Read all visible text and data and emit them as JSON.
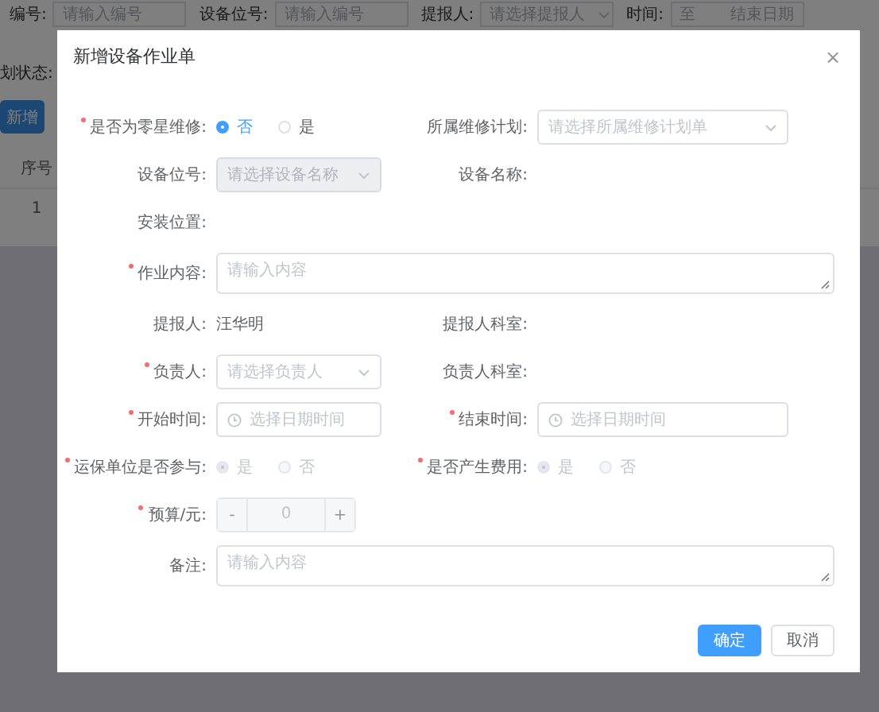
{
  "page": {
    "filters": [
      {
        "label": "编号:",
        "placeholder": "请输入编号",
        "kind": "input"
      },
      {
        "label": "设备位号:",
        "placeholder": "请输入编号",
        "kind": "input"
      },
      {
        "label": "提报人:",
        "placeholder": "请选择提报人",
        "kind": "select"
      },
      {
        "label": "时间:",
        "placeholder": "至",
        "placeholder_end": "结束日期",
        "kind": "range"
      }
    ],
    "status_filter_label": "划状态:",
    "buttons": [
      "新增"
    ],
    "table": {
      "columns": [
        "序号"
      ],
      "rows": [
        [
          "1"
        ]
      ]
    }
  },
  "dialog": {
    "title": "新增设备作业单",
    "close": "×",
    "rows": [
      [
        {
          "label": "是否为零星维修:",
          "required": true,
          "kind": "radio",
          "disabled": false,
          "options": [
            {
              "label": "否",
              "selected": true
            },
            {
              "label": "是",
              "selected": false
            }
          ]
        },
        {
          "label": "所属维修计划:",
          "required": false,
          "kind": "select",
          "placeholder": "请选择所属维修计划单",
          "disabled": false
        }
      ],
      [
        {
          "label": "设备位号:",
          "required": false,
          "kind": "select",
          "placeholder": "请选择设备名称",
          "disabled": true
        },
        {
          "label": "设备名称:",
          "required": false,
          "kind": "static"
        }
      ],
      [
        {
          "label": "安装位置:",
          "required": false,
          "kind": "static"
        }
      ],
      [
        {
          "label": "作业内容:",
          "required": true,
          "kind": "textarea",
          "placeholder": "请输入内容"
        }
      ],
      [
        {
          "label": "提报人:",
          "required": false,
          "kind": "static",
          "value": "汪华明"
        },
        {
          "label": "提报人科室:",
          "required": false,
          "kind": "static"
        }
      ],
      [
        {
          "label": "负责人:",
          "required": true,
          "kind": "select",
          "placeholder": "请选择负责人",
          "disabled": false
        },
        {
          "label": "负责人科室:",
          "required": false,
          "kind": "static"
        }
      ],
      [
        {
          "label": "开始时间:",
          "required": true,
          "kind": "date",
          "placeholder": "选择日期时间"
        },
        {
          "label": "结束时间:",
          "required": true,
          "kind": "date",
          "placeholder": "选择日期时间"
        }
      ],
      [
        {
          "label": "运保单位是否参与:",
          "required": true,
          "kind": "radio",
          "disabled": true,
          "options": [
            {
              "label": "是",
              "selected": true
            },
            {
              "label": "否",
              "selected": false
            }
          ]
        },
        {
          "label": "是否产生费用:",
          "required": true,
          "kind": "radio",
          "disabled": true,
          "options": [
            {
              "label": "是",
              "selected": true
            },
            {
              "label": "否",
              "selected": false
            }
          ]
        }
      ],
      [
        {
          "label": "预算/元:",
          "required": true,
          "kind": "number",
          "value": "0",
          "minus": "-",
          "plus": "+",
          "disabled": true
        }
      ],
      [
        {
          "label": "备注:",
          "required": false,
          "kind": "textarea",
          "placeholder": "请输入内容"
        }
      ]
    ],
    "buttons": [
      {
        "label": "确定",
        "kind": "primary"
      },
      {
        "label": "取消",
        "kind": "default"
      }
    ]
  }
}
